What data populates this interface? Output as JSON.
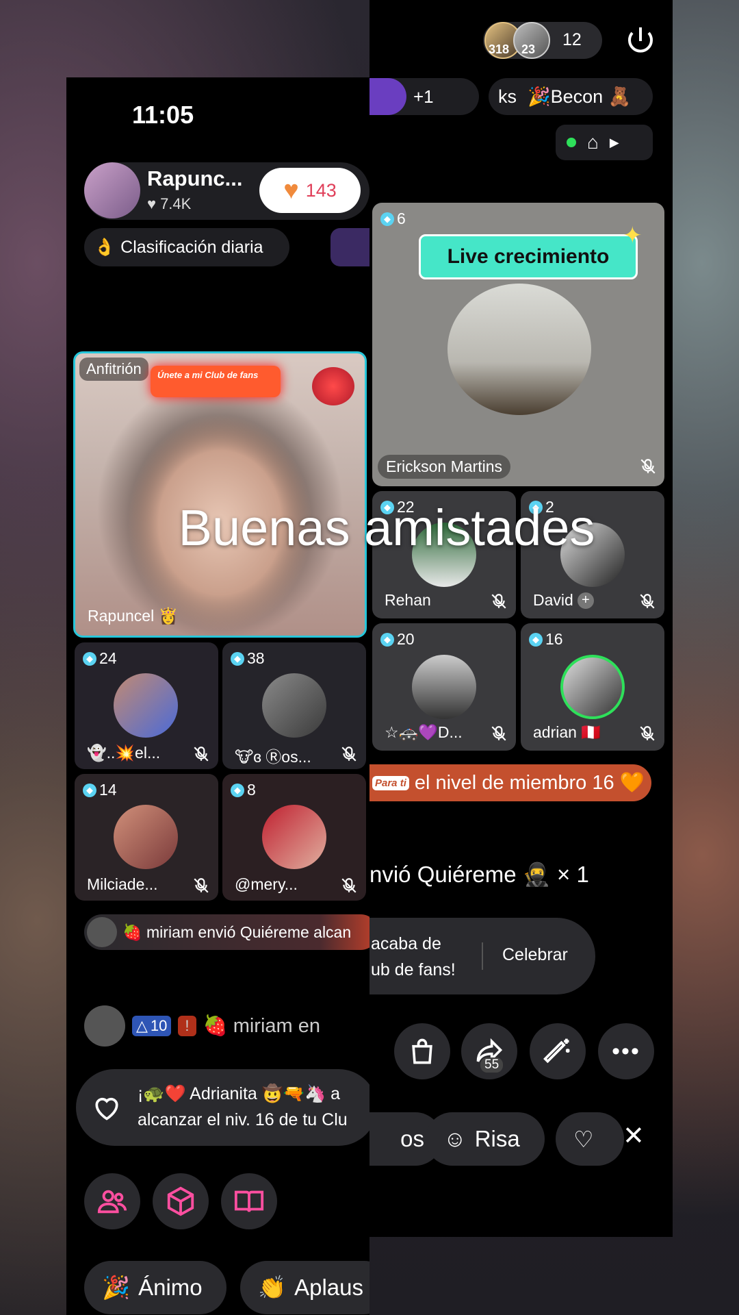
{
  "overlay_caption": "Buenas amistades",
  "left": {
    "status_time": "11:05",
    "host": {
      "name": "Rapunc...",
      "likes": "7.4K",
      "heart_count": "143"
    },
    "daily_ranking": "Clasificación diaria",
    "host_tile": {
      "tag": "Anfitrión",
      "banner": "Únete a mi Club de fans",
      "name": "Rapuncel 👸"
    },
    "guests": [
      {
        "level": "24",
        "name": "👻..💥el..."
      },
      {
        "level": "38",
        "name": "🐮ɞ Ⓡos..."
      },
      {
        "level": "14",
        "name": "Milciade..."
      },
      {
        "level": "8",
        "name": "@mery..."
      }
    ],
    "gift_banner": "🍓 miriam envió Quiéreme alcan",
    "chat": {
      "level": "10",
      "name": "🍓 miriam en"
    },
    "fan_message": {
      "line1": "¡🐢❤️ Adrianita 🤠🔫🦄 a",
      "line2": "alcanzar el niv. 16 de tu Clu"
    },
    "reactions": {
      "animo": "Ánimo",
      "aplausos": "Aplaus"
    }
  },
  "right": {
    "viewers_count": "12",
    "viewer_badges": [
      "318",
      "23"
    ],
    "top_chips": {
      "plus": "+1",
      "ks": "ks",
      "becon": "🎉Becon 🧸"
    },
    "main_tile": {
      "level": "6",
      "banner": "Live crecimiento",
      "name": "Erickson Martins"
    },
    "guests": [
      {
        "level": "22",
        "name": "Rehan"
      },
      {
        "level": "2",
        "name": "David"
      },
      {
        "level": "20",
        "name": "☆🚓💜D..."
      },
      {
        "level": "16",
        "name": "adrian 🇵🇪"
      }
    ],
    "member_banner": {
      "sticker": "Para ti",
      "text": "el nivel de miembro 16 🧡"
    },
    "gift_line": "nvió Quiéreme 🥷 × 1",
    "fanclub_toast": {
      "line1": "acaba de",
      "line2": "ub de fans!",
      "action": "Celebrar"
    },
    "share_count": "55",
    "reactions": {
      "partial": "os",
      "risa": "Risa"
    }
  },
  "colors": {
    "accent_teal": "#26c6da",
    "heart_orange": "#f08a3c",
    "mint": "#40e0d0",
    "pink_count": "#e0405a"
  }
}
